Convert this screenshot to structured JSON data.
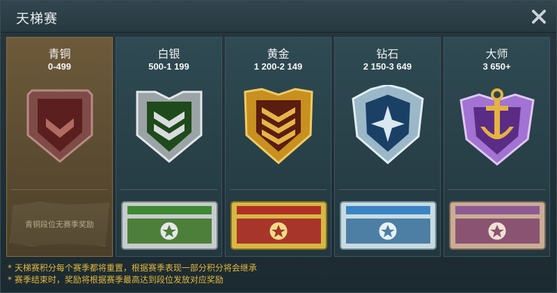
{
  "window": {
    "title": "天梯赛"
  },
  "tiers": [
    {
      "name": "青铜",
      "range": "0-499",
      "reward_note": "青铜段位无赛季奖励"
    },
    {
      "name": "白银",
      "range": "500-1 199"
    },
    {
      "name": "黄金",
      "range": "1 200-2 149"
    },
    {
      "name": "钻石",
      "range": "2 150-3 649"
    },
    {
      "name": "大师",
      "range": "3 650+"
    }
  ],
  "notes": [
    "* 天梯赛积分每个赛季都将重置，根据赛季表现一部分积分将会继承",
    "* 赛季结束时，奖励将根据赛季最高达到段位发放对应奖励"
  ],
  "colors": {
    "bronze": "#8a3c35",
    "silver": "#3d6a2e",
    "gold": "#c8901e",
    "diamond": "#3a77a8",
    "master": "#8a56b8",
    "note": "#e3b93b"
  },
  "icons": [
    "close-icon",
    "bronze-rank-badge-icon",
    "silver-rank-badge-icon",
    "gold-rank-badge-icon",
    "diamond-rank-badge-icon",
    "master-rank-badge-icon",
    "reward-crate-icon"
  ]
}
